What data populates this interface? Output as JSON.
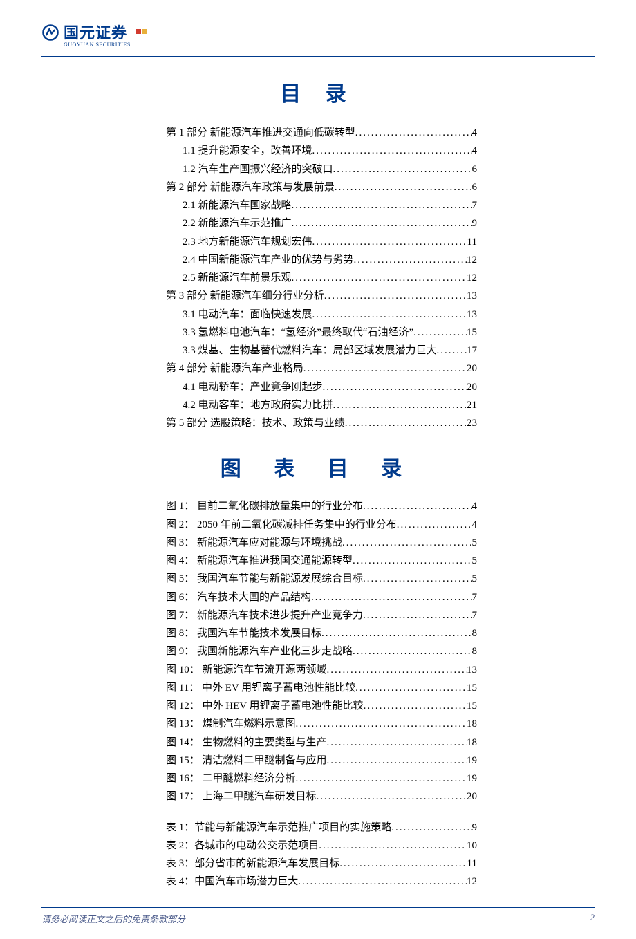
{
  "logo": {
    "cn": "国元证券",
    "en": "GUOYUAN SECURITIES"
  },
  "titles": {
    "toc": "目 录",
    "figures": "图 表 目 录"
  },
  "toc": [
    {
      "level": 0,
      "label": "第 1 部分 新能源汽车推进交通向低碳转型",
      "page": "4"
    },
    {
      "level": 1,
      "label": "1.1 提升能源安全，改善环境",
      "page": "4"
    },
    {
      "level": 1,
      "label": "1.2 汽车生产国振兴经济的突破口",
      "page": "6"
    },
    {
      "level": 0,
      "label": "第 2 部分 新能源汽车政策与发展前景",
      "page": "6"
    },
    {
      "level": 1,
      "label": "2.1 新能源汽车国家战略",
      "page": "7"
    },
    {
      "level": 1,
      "label": "2.2 新能源汽车示范推广",
      "page": "9"
    },
    {
      "level": 1,
      "label": "2.3 地方新能源汽车规划宏伟",
      "page": "11"
    },
    {
      "level": 1,
      "label": "2.4 中国新能源汽车产业的优势与劣势",
      "page": "12"
    },
    {
      "level": 1,
      "label": "2.5 新能源汽车前景乐观",
      "page": "12"
    },
    {
      "level": 0,
      "label": "第 3 部分 新能源汽车细分行业分析",
      "page": "13"
    },
    {
      "level": 1,
      "label": "3.1 电动汽车：面临快速发展 ",
      "page": "13"
    },
    {
      "level": 1,
      "label": "3.3 氢燃料电池汽车：“氢经济”最终取代“石油经济” ",
      "page": "15"
    },
    {
      "level": 1,
      "label": "3.3 煤基、生物基替代燃料汽车：局部区域发展潜力巨大 ",
      "page": "17"
    },
    {
      "level": 0,
      "label": "第 4 部分 新能源汽车产业格局",
      "page": "20"
    },
    {
      "level": 1,
      "label": "4.1 电动轿车：产业竞争刚起步 ",
      "page": "20"
    },
    {
      "level": 1,
      "label": "4.2 电动客车：地方政府实力比拼 ",
      "page": "21"
    },
    {
      "level": 0,
      "label": "第 5 部分 选股策略：技术、政策与业绩",
      "page": "23"
    }
  ],
  "figures": [
    {
      "label": "图 1： 目前二氧化碳排放量集中的行业分布",
      "page": "4"
    },
    {
      "label": "图 2： 2050 年前二氧化碳减排任务集中的行业分布",
      "page": "4"
    },
    {
      "label": "图 3： 新能源汽车应对能源与环境挑战",
      "page": "5"
    },
    {
      "label": "图 4： 新能源汽车推进我国交通能源转型",
      "page": "5"
    },
    {
      "label": "图 5： 我国汽车节能与新能源发展综合目标",
      "page": "5"
    },
    {
      "label": "图 6： 汽车技术大国的产品结构",
      "page": "7"
    },
    {
      "label": "图 7： 新能源汽车技术进步提升产业竞争力",
      "page": "7"
    },
    {
      "label": "图 8： 我国汽车节能技术发展目标",
      "page": "8"
    },
    {
      "label": "图 9： 我国新能源汽车产业化三步走战略",
      "page": "8"
    },
    {
      "label": "图 10： 新能源汽车节流开源两领域",
      "page": "13"
    },
    {
      "label": "图 11： 中外 EV 用锂离子蓄电池性能比较",
      "page": "15"
    },
    {
      "label": "图 12： 中外 HEV 用锂离子蓄电池性能比较",
      "page": "15"
    },
    {
      "label": "图 13： 煤制汽车燃料示意图",
      "page": "18"
    },
    {
      "label": "图 14： 生物燃料的主要类型与生产",
      "page": "18"
    },
    {
      "label": "图 15： 清洁燃料二甲醚制备与应用",
      "page": "19"
    },
    {
      "label": "图 16： 二甲醚燃料经济分析",
      "page": "19"
    },
    {
      "label": "图 17： 上海二甲醚汽车研发目标",
      "page": "20"
    }
  ],
  "tables": [
    {
      "label": "表 1：节能与新能源汽车示范推广项目的实施策略",
      "page": "9"
    },
    {
      "label": "表 2：各城市的电动公交示范项目",
      "page": "10"
    },
    {
      "label": "表 3：部分省市的新能源汽车发展目标",
      "page": "11"
    },
    {
      "label": "表 4：中国汽车市场潜力巨大",
      "page": "12"
    }
  ],
  "footer": {
    "disclaimer": "请务必阅读正文之后的免责条款部分",
    "page_number": "2"
  }
}
